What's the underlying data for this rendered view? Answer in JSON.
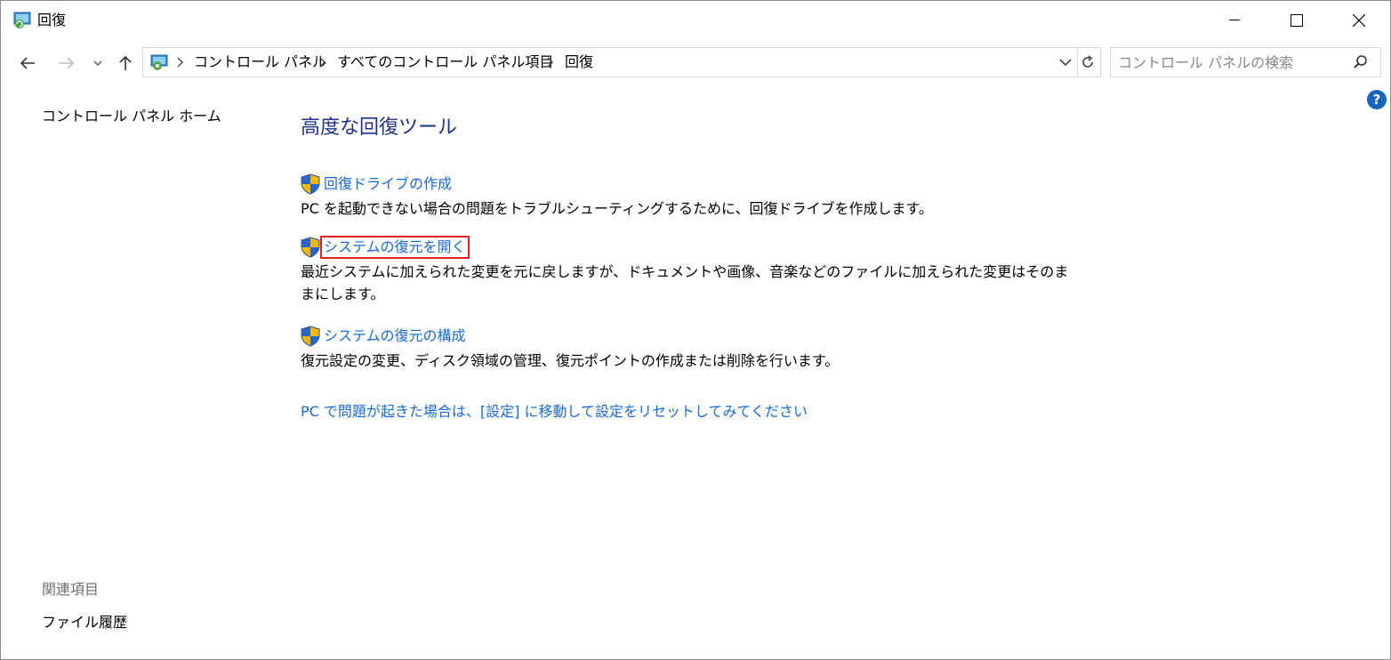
{
  "window": {
    "title": "回復",
    "minimize_icon": "minimize-icon",
    "maximize_icon": "maximize-icon",
    "close_icon": "close-icon"
  },
  "nav": {
    "breadcrumbs": [
      {
        "label": "コントロール パネル"
      },
      {
        "label": "すべてのコントロール パネル項目"
      },
      {
        "label": "回復"
      }
    ],
    "search_placeholder": "コントロール パネルの検索"
  },
  "sidebar": {
    "home_link": "コントロール パネル ホーム",
    "related_heading": "関連項目",
    "related_items": [
      {
        "label": "ファイル履歴"
      }
    ]
  },
  "main": {
    "heading": "高度な回復ツール",
    "tools": [
      {
        "link": "回復ドライブの作成",
        "description": "PC を起動できない場合の問題をトラブルシューティングするために、回復ドライブを作成します。"
      },
      {
        "link": "システムの復元を開く",
        "description": "最近システムに加えられた変更を元に戻しますが、ドキュメントや画像、音楽などのファイルに加えられた変更はそのままにします。"
      },
      {
        "link": "システムの復元の構成",
        "description": "復元設定の変更、ディスク領域の管理、復元ポイントの作成または削除を行います。"
      }
    ],
    "reset_link": "PC で問題が起きた場合は、[設定] に移動して設定をリセットしてみてください"
  },
  "help": "?",
  "colors": {
    "link": "#1a6ad6",
    "heading": "#1e3287",
    "highlight_box": "#e02020",
    "help_button": "#1565c0"
  }
}
